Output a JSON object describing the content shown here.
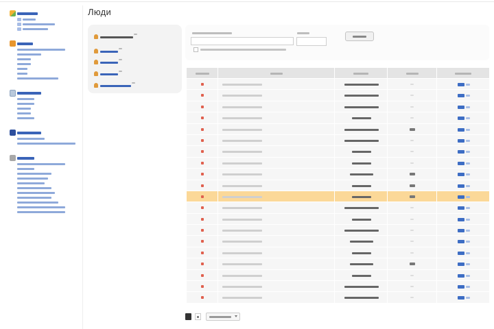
{
  "page": {
    "title": "Люди"
  },
  "colors": {
    "link": "#3a64b8",
    "link_light": "#8ea9da",
    "text_dark": "#666666",
    "text_light": "#cfcfcf",
    "status_icon": "#e0604e",
    "highlight_row": "#fbd898",
    "header_bg": "#e4e4e4",
    "panel_bg": "#f3f3f3"
  },
  "sidebar": {
    "groups": [
      {
        "icon": "folder-icon",
        "items": [
          {
            "type": "link",
            "with_icon": true
          },
          {
            "type": "link",
            "with_icon": true
          },
          {
            "type": "link",
            "with_icon": true
          }
        ]
      },
      {
        "icon": "package-icon",
        "items": [
          {
            "type": "link"
          },
          {
            "type": "link"
          },
          {
            "type": "link"
          },
          {
            "type": "link"
          },
          {
            "type": "link"
          },
          {
            "type": "link"
          },
          {
            "type": "link"
          }
        ]
      },
      {
        "icon": "documents-icon",
        "items": [
          {
            "type": "link"
          },
          {
            "type": "link"
          },
          {
            "type": "link"
          },
          {
            "type": "link"
          },
          {
            "type": "link"
          }
        ]
      },
      {
        "icon": "square-icon",
        "items": [
          {
            "type": "link"
          },
          {
            "type": "link"
          }
        ]
      },
      {
        "icon": "settings-icon",
        "items": [
          {
            "type": "link"
          },
          {
            "type": "link"
          },
          {
            "type": "link"
          },
          {
            "type": "link"
          },
          {
            "type": "link"
          },
          {
            "type": "link"
          },
          {
            "type": "link"
          },
          {
            "type": "link"
          },
          {
            "type": "link"
          },
          {
            "type": "link"
          },
          {
            "type": "link"
          }
        ]
      }
    ]
  },
  "filter_panel": {
    "items": [
      {
        "icon": "user-icon",
        "active": true
      },
      {
        "icon": "user-icon",
        "active": false
      },
      {
        "icon": "user-icon",
        "active": false
      },
      {
        "icon": "user-icon",
        "active": false
      },
      {
        "icon": "user-icon",
        "active": false
      }
    ]
  },
  "search": {
    "checkbox_checked": false
  },
  "table": {
    "rows": [
      {
        "marked": false,
        "highlighted": false
      },
      {
        "marked": false,
        "highlighted": false
      },
      {
        "marked": false,
        "highlighted": false
      },
      {
        "marked": false,
        "highlighted": false
      },
      {
        "marked": true,
        "highlighted": false
      },
      {
        "marked": false,
        "highlighted": false
      },
      {
        "marked": false,
        "highlighted": false
      },
      {
        "marked": false,
        "highlighted": false
      },
      {
        "marked": true,
        "highlighted": false
      },
      {
        "marked": true,
        "highlighted": false
      },
      {
        "marked": true,
        "highlighted": true
      },
      {
        "marked": false,
        "highlighted": false
      },
      {
        "marked": false,
        "highlighted": false
      },
      {
        "marked": false,
        "highlighted": false
      },
      {
        "marked": false,
        "highlighted": false
      },
      {
        "marked": false,
        "highlighted": false
      },
      {
        "marked": true,
        "highlighted": false
      },
      {
        "marked": false,
        "highlighted": false
      },
      {
        "marked": false,
        "highlighted": false
      },
      {
        "marked": false,
        "highlighted": false
      }
    ]
  }
}
